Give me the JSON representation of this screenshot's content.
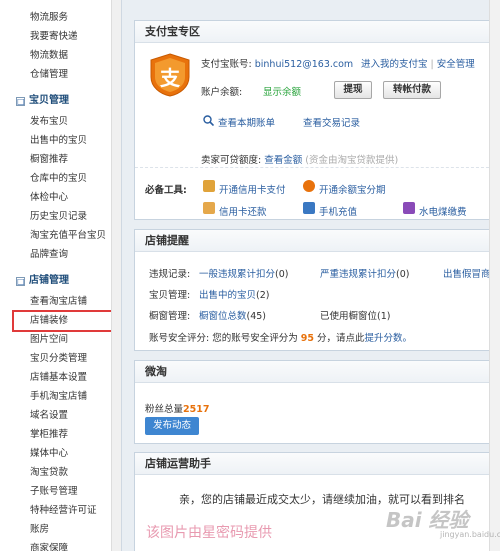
{
  "sidebar": {
    "top_items": [
      "物流服务",
      "我要寄快递",
      "物流数据",
      "仓储管理"
    ],
    "sections": [
      {
        "toggle": "□",
        "title": "宝贝管理",
        "items": [
          "发布宝贝",
          "出售中的宝贝",
          "橱窗推荐",
          "仓库中的宝贝",
          "体检中心",
          "历史宝贝记录",
          "淘宝充值平台宝贝",
          "品牌查询"
        ]
      },
      {
        "toggle": "□",
        "title": "店铺管理",
        "items": [
          "查看淘宝店铺",
          "店铺装修",
          "图片空间",
          "宝贝分类管理",
          "店铺基本设置",
          "手机淘宝店铺",
          "域名设置",
          "掌柜推荐",
          "媒体中心",
          "淘宝贷款",
          "子账号管理",
          "特种经营许可证",
          "账房",
          "商家保障"
        ]
      }
    ],
    "selected_item": "店铺装修"
  },
  "alipay": {
    "title": "支付宝专区",
    "logo_glyph": "支",
    "account_label": "支付宝账号:",
    "account_value": "binhui512@163.com",
    "enter_link": "进入我的支付宝",
    "separator": "|",
    "security_link": "安全管理",
    "balance_label": "账户余额:",
    "balance_link": "显示余额",
    "withdraw_button": "提现",
    "transfer_button": "转帐付款",
    "bill_link": "查看本期账单",
    "trade_link": "查看交易记录",
    "seller_label": "卖家可贷额度:",
    "seller_link": "查看金额",
    "seller_note": "(资金由淘宝贷款提供)",
    "tools_label": "必备工具:",
    "tools": [
      "开通信用卡支付",
      "开通余额宝分期",
      "信用卡还款",
      "手机充值",
      "水电煤缴费"
    ]
  },
  "shop_reminder": {
    "title": "店铺提醒",
    "violation_label": "违规记录:",
    "violation_general": "一般违规累计扣分",
    "violation_general_count": "(0)",
    "violation_serious": "严重违规累计扣分",
    "violation_serious_count": "(0)",
    "violation_fake": "出售假冒商品",
    "goods_label": "宝贝管理:",
    "goods_link": "出售中的宝贝",
    "goods_count": "(2)",
    "showcase_label": "橱窗管理:",
    "showcase_link": "橱窗位总数",
    "showcase_count": "(45)",
    "showcase_used": "已使用橱窗位(1)",
    "security_prefix": "账号安全评分: 您的账号安全评分为",
    "security_score": "95",
    "security_suffix": "分，请点此",
    "security_link": "提升分数。"
  },
  "weitao": {
    "title": "微淘",
    "fans_label": "粉丝总量",
    "fans_count": "2517",
    "publish_button": "发布动态"
  },
  "assistant": {
    "title": "店铺运营助手",
    "message": "亲，您的店铺最近成交太少，请继续加油，就可以看到排名"
  },
  "watermark": "该图片由星密码提供",
  "baidu_mark": "Bai 经验",
  "baidu_url": "jingyan.baidu.com",
  "colors": {
    "link": "#2a5ea0",
    "highlight_border": "#e03a3a",
    "score": "#e8720c",
    "balance_link": "#27a33a",
    "button_blue": "#3e86d1"
  }
}
